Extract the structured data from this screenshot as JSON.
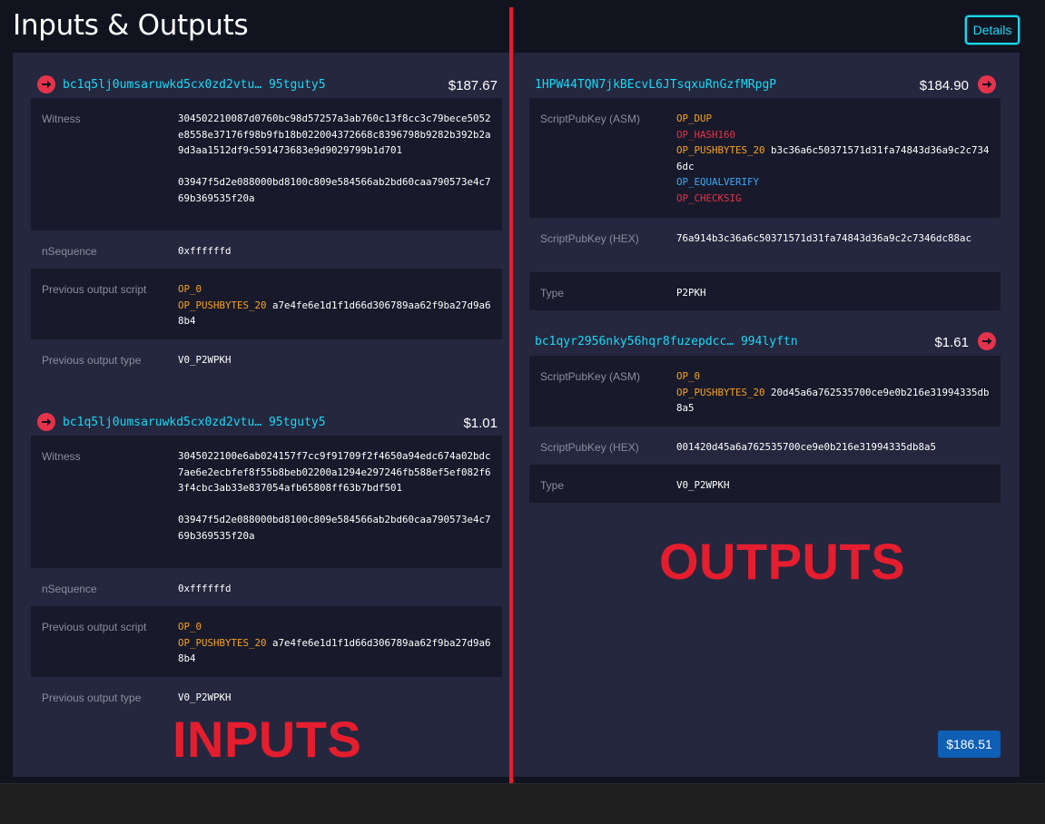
{
  "header": {
    "title": "Inputs & Outputs",
    "details_label": "Details"
  },
  "inputs": [
    {
      "address": "bc1q5lj0umsaruwkd5cx0zd2vtu… 95tguty5",
      "amount": "$187.67",
      "witness_label": "Witness",
      "witness_1": "304502210087d0760bc98d57257a3ab760c13f8cc3c79bece5052e8558e37176f98b9fb18b022004372668c8396798b9282b392b2a9d3aa1512df9c591473683e9d9029799b1d701",
      "witness_2": "03947f5d2e088000bd8100c809e584566ab2bd60caa790573e4c769b369535f20a",
      "nsequence_label": "nSequence",
      "nsequence": "0xffffffd",
      "prevscript_label": "Previous output script",
      "prevscript_op0": "OP_0",
      "prevscript_push": "OP_PUSHBYTES_20",
      "prevscript_data": "a7e4fe6e1d1f1d66d306789aa62f9ba27d9a68b4",
      "prevtype_label": "Previous output type",
      "prevtype": "V0_P2WPKH"
    },
    {
      "address": "bc1q5lj0umsaruwkd5cx0zd2vtu… 95tguty5",
      "amount": "$1.01",
      "witness_label": "Witness",
      "witness_1": "3045022100e6ab024157f7cc9f91709f2f4650a94edc674a02bdc7ae6e2ecbfef8f55b8beb02200a1294e297246fb588ef5ef082f63f4cbc3ab33e837054afb65808ff63b7bdf501",
      "witness_2": "03947f5d2e088000bd8100c809e584566ab2bd60caa790573e4c769b369535f20a",
      "nsequence_label": "nSequence",
      "nsequence": "0xffffffd",
      "prevscript_label": "Previous output script",
      "prevscript_op0": "OP_0",
      "prevscript_push": "OP_PUSHBYTES_20",
      "prevscript_data": "a7e4fe6e1d1f1d66d306789aa62f9ba27d9a68b4",
      "prevtype_label": "Previous output type",
      "prevtype": "V0_P2WPKH"
    }
  ],
  "outputs": [
    {
      "address": "1HPW44TQN7jkBEcvL6JTsqxuRnGzfMRpgP",
      "amount": "$184.90",
      "asm_label": "ScriptPubKey (ASM)",
      "asm_dup": "OP_DUP",
      "asm_hash160": "OP_HASH160",
      "asm_push": "OP_PUSHBYTES_20",
      "asm_data": "b3c36a6c50371571d31fa74843d36a9c2c7346dc",
      "asm_equalverify": "OP_EQUALVERIFY",
      "asm_checksig": "OP_CHECKSIG",
      "hex_label": "ScriptPubKey (HEX)",
      "hex": "76a914b3c36a6c50371571d31fa74843d36a9c2c7346dc88ac",
      "type_label": "Type",
      "type": "P2PKH"
    },
    {
      "address": "bc1qyr2956nky56hqr8fuzepdcc… 994lyftn",
      "amount": "$1.61",
      "asm_label": "ScriptPubKey (ASM)",
      "asm_op0": "OP_0",
      "asm_push": "OP_PUSHBYTES_20",
      "asm_data": "20d45a6a762535700ce9e0b216e31994335db8a5",
      "hex_label": "ScriptPubKey (HEX)",
      "hex": "001420d45a6a762535700ce9e0b216e31994335db8a5",
      "type_label": "Type",
      "type": "V0_P2WPKH"
    }
  ],
  "total": "$186.51",
  "annotations": {
    "inputs": "INPUTS",
    "outputs": "OUTPUTS"
  },
  "icons": {
    "input_arrow": "arrow-right-circle-icon",
    "output_arrow": "arrow-right-circle-icon"
  },
  "colors": {
    "accent": "#1bd8f4",
    "red": "#e5334b",
    "orange": "#f6a123",
    "blue": "#3fa9f5",
    "badge": "#0f5fb5"
  }
}
